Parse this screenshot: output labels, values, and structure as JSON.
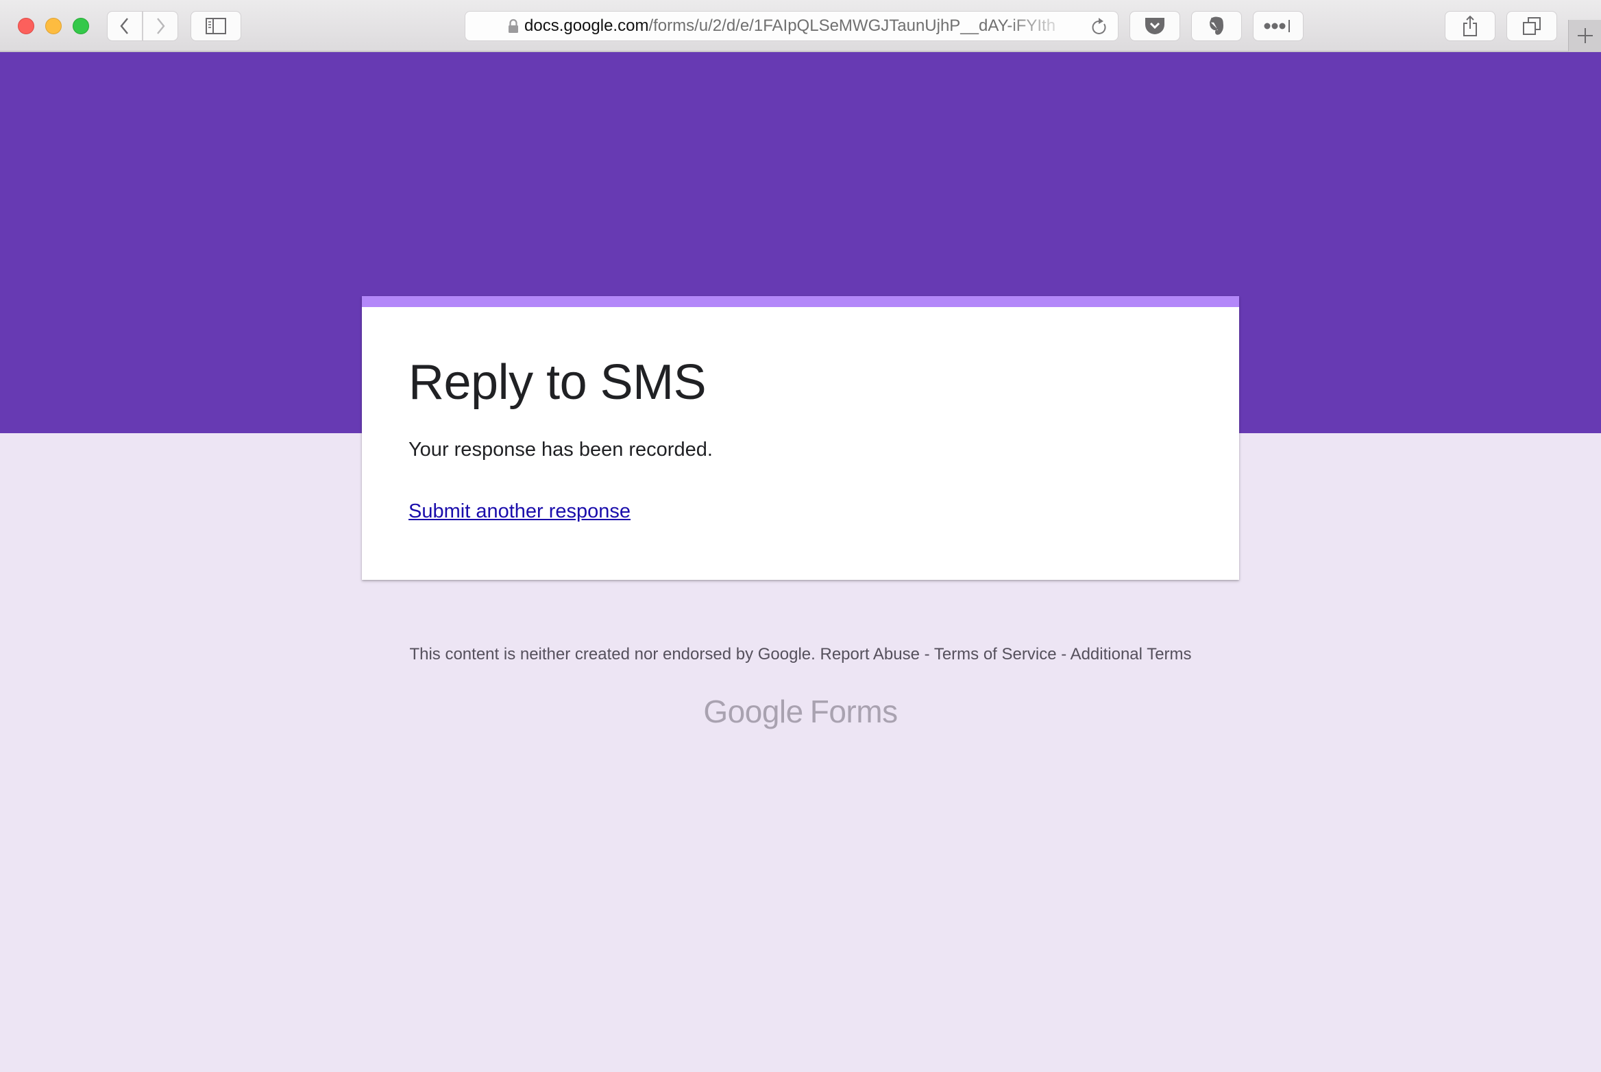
{
  "browser": {
    "url_host": "docs.google.com",
    "url_path": "/forms/u/2/d/e/1FAIpQLSeMWGJTaunUjhP__dAY-iFYIth",
    "buttons": {
      "back": "back-icon",
      "forward": "forward-icon",
      "sidebar": "sidebar-icon",
      "reload": "reload-icon",
      "pocket": "pocket-icon",
      "evernote": "evernote-icon",
      "more": "more-extensions-icon",
      "share": "share-icon",
      "tabs": "tabs-overview-icon",
      "new_tab": "plus-icon"
    }
  },
  "colors": {
    "banner": "#673ab3",
    "accent": "#b387f9",
    "page_background": "#ede5f4",
    "link": "#1a0dab"
  },
  "form": {
    "title": "Reply to SMS",
    "confirmation": "Your response has been recorded.",
    "submit_another": "Submit another response"
  },
  "footer": {
    "disclaimer": "This content is neither created nor endorsed by Google.",
    "report_abuse": "Report Abuse",
    "separator": "-",
    "terms": "Terms of Service",
    "additional_terms": "Additional Terms"
  },
  "logo": {
    "google": "Google",
    "product": "Forms"
  }
}
